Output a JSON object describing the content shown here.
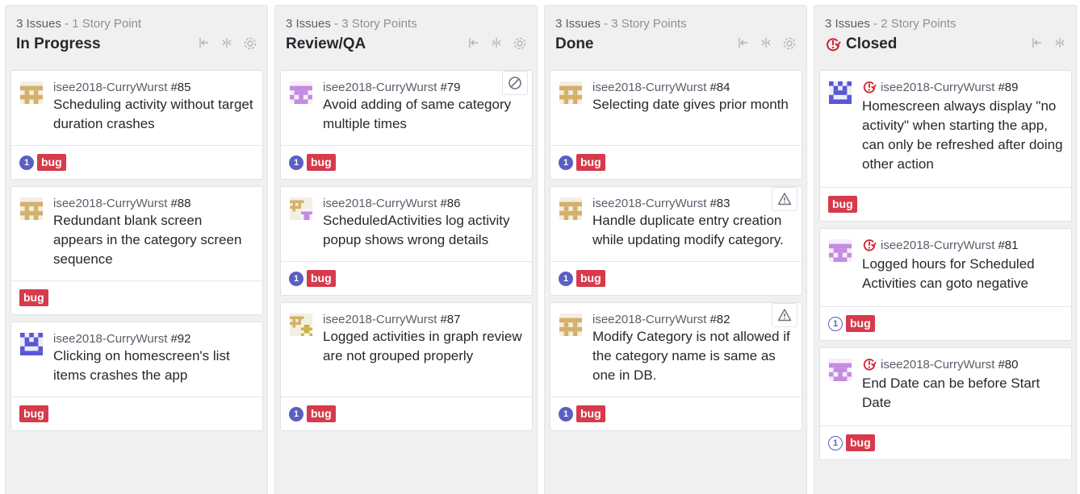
{
  "columns": [
    {
      "issues": "3 Issues",
      "separator": " - ",
      "points": "1 Story Point",
      "title": "In Progress",
      "closed": false,
      "cards": [
        {
          "repo": "isee2018-CurryWurst",
          "number": "#85",
          "title": "Scheduling activity without target duration crashes",
          "avatar": "tan",
          "points": "1",
          "label": "bug",
          "corner": ""
        },
        {
          "repo": "isee2018-CurryWurst",
          "number": "#88",
          "title": "Redundant blank screen appears in the category screen sequence",
          "avatar": "tan",
          "points": "",
          "label": "bug",
          "corner": ""
        },
        {
          "repo": "isee2018-CurryWurst",
          "number": "#92",
          "title": "Clicking on homescreen's list items crashes the app",
          "avatar": "blue",
          "points": "",
          "label": "bug",
          "corner": ""
        }
      ]
    },
    {
      "issues": "3 Issues",
      "separator": " - ",
      "points": "3 Story Points",
      "title": "Review/QA",
      "closed": false,
      "cards": [
        {
          "repo": "isee2018-CurryWurst",
          "number": "#79",
          "title": "Avoid adding of same category multiple times",
          "avatar": "purple",
          "points": "1",
          "label": "bug",
          "corner": "blocked"
        },
        {
          "repo": "isee2018-CurryWurst",
          "number": "#86",
          "title": "ScheduledActivities log activity popup shows wrong details",
          "avatar": "tan-purple",
          "points": "1",
          "label": "bug",
          "corner": ""
        },
        {
          "repo": "isee2018-CurryWurst",
          "number": "#87",
          "title": "Logged activities in graph review are not grouped properly",
          "avatar": "tan-tan",
          "points": "1",
          "label": "bug",
          "corner": ""
        }
      ]
    },
    {
      "issues": "3 Issues",
      "separator": " - ",
      "points": "3 Story Points",
      "title": "Done",
      "closed": false,
      "cards": [
        {
          "repo": "isee2018-CurryWurst",
          "number": "#84",
          "title": "Selecting date gives prior month",
          "avatar": "tan",
          "points": "1",
          "label": "bug",
          "corner": ""
        },
        {
          "repo": "isee2018-CurryWurst",
          "number": "#83",
          "title": "Handle duplicate entry creation while updating modify category.",
          "avatar": "tan",
          "points": "1",
          "label": "bug",
          "corner": "warning"
        },
        {
          "repo": "isee2018-CurryWurst",
          "number": "#82",
          "title": "Modify Category is not allowed if the category name is same as one in DB.",
          "avatar": "tan",
          "points": "1",
          "label": "bug",
          "corner": "warning"
        }
      ]
    },
    {
      "issues": "3 Issues",
      "separator": " - ",
      "points": "2 Story Points",
      "title": "Closed",
      "closed": true,
      "cards": [
        {
          "repo": "isee2018-CurryWurst",
          "number": "#89",
          "title": "Homescreen always display \"no activity\" when starting the app, can only be refreshed after doing other action",
          "avatar": "blue",
          "points": "",
          "label": "bug",
          "corner": ""
        },
        {
          "repo": "isee2018-CurryWurst",
          "number": "#81",
          "title": "Logged hours for Scheduled Activities can goto negative",
          "avatar": "purple",
          "points": "1",
          "label": "bug",
          "corner": ""
        },
        {
          "repo": "isee2018-CurryWurst",
          "number": "#80",
          "title": "End Date can be before Start Date",
          "avatar": "purple",
          "points": "1",
          "label": "bug",
          "corner": ""
        }
      ]
    }
  ],
  "colors": {
    "bug_label": "#d73a4a",
    "point_badge": "#5a5fc4",
    "closed_icon": "#cb2431",
    "column_bg": "#f0f0f0"
  }
}
